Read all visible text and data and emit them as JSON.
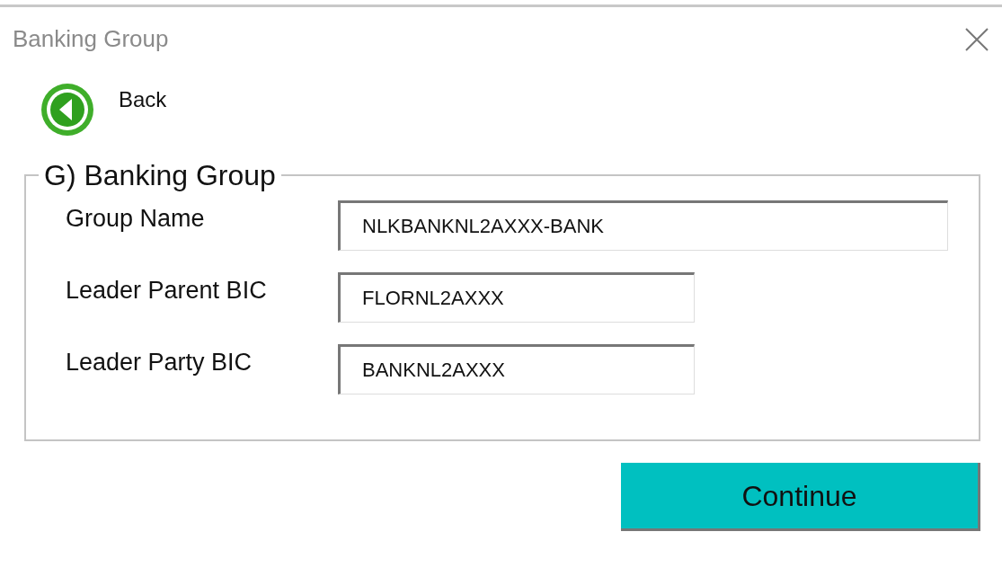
{
  "window": {
    "title": "Banking Group"
  },
  "back": {
    "label": "Back"
  },
  "group": {
    "legend": "G) Banking Group",
    "fields": [
      {
        "label": "Group Name",
        "value": "NLKBANKNL2AXXX-BANK",
        "wide": true
      },
      {
        "label": "Leader Parent BIC",
        "value": "FLORNL2AXXX",
        "wide": false
      },
      {
        "label": "Leader Party BIC",
        "value": "BANKNL2AXXX",
        "wide": false
      }
    ]
  },
  "buttons": [
    {
      "label": "Continue"
    }
  ]
}
